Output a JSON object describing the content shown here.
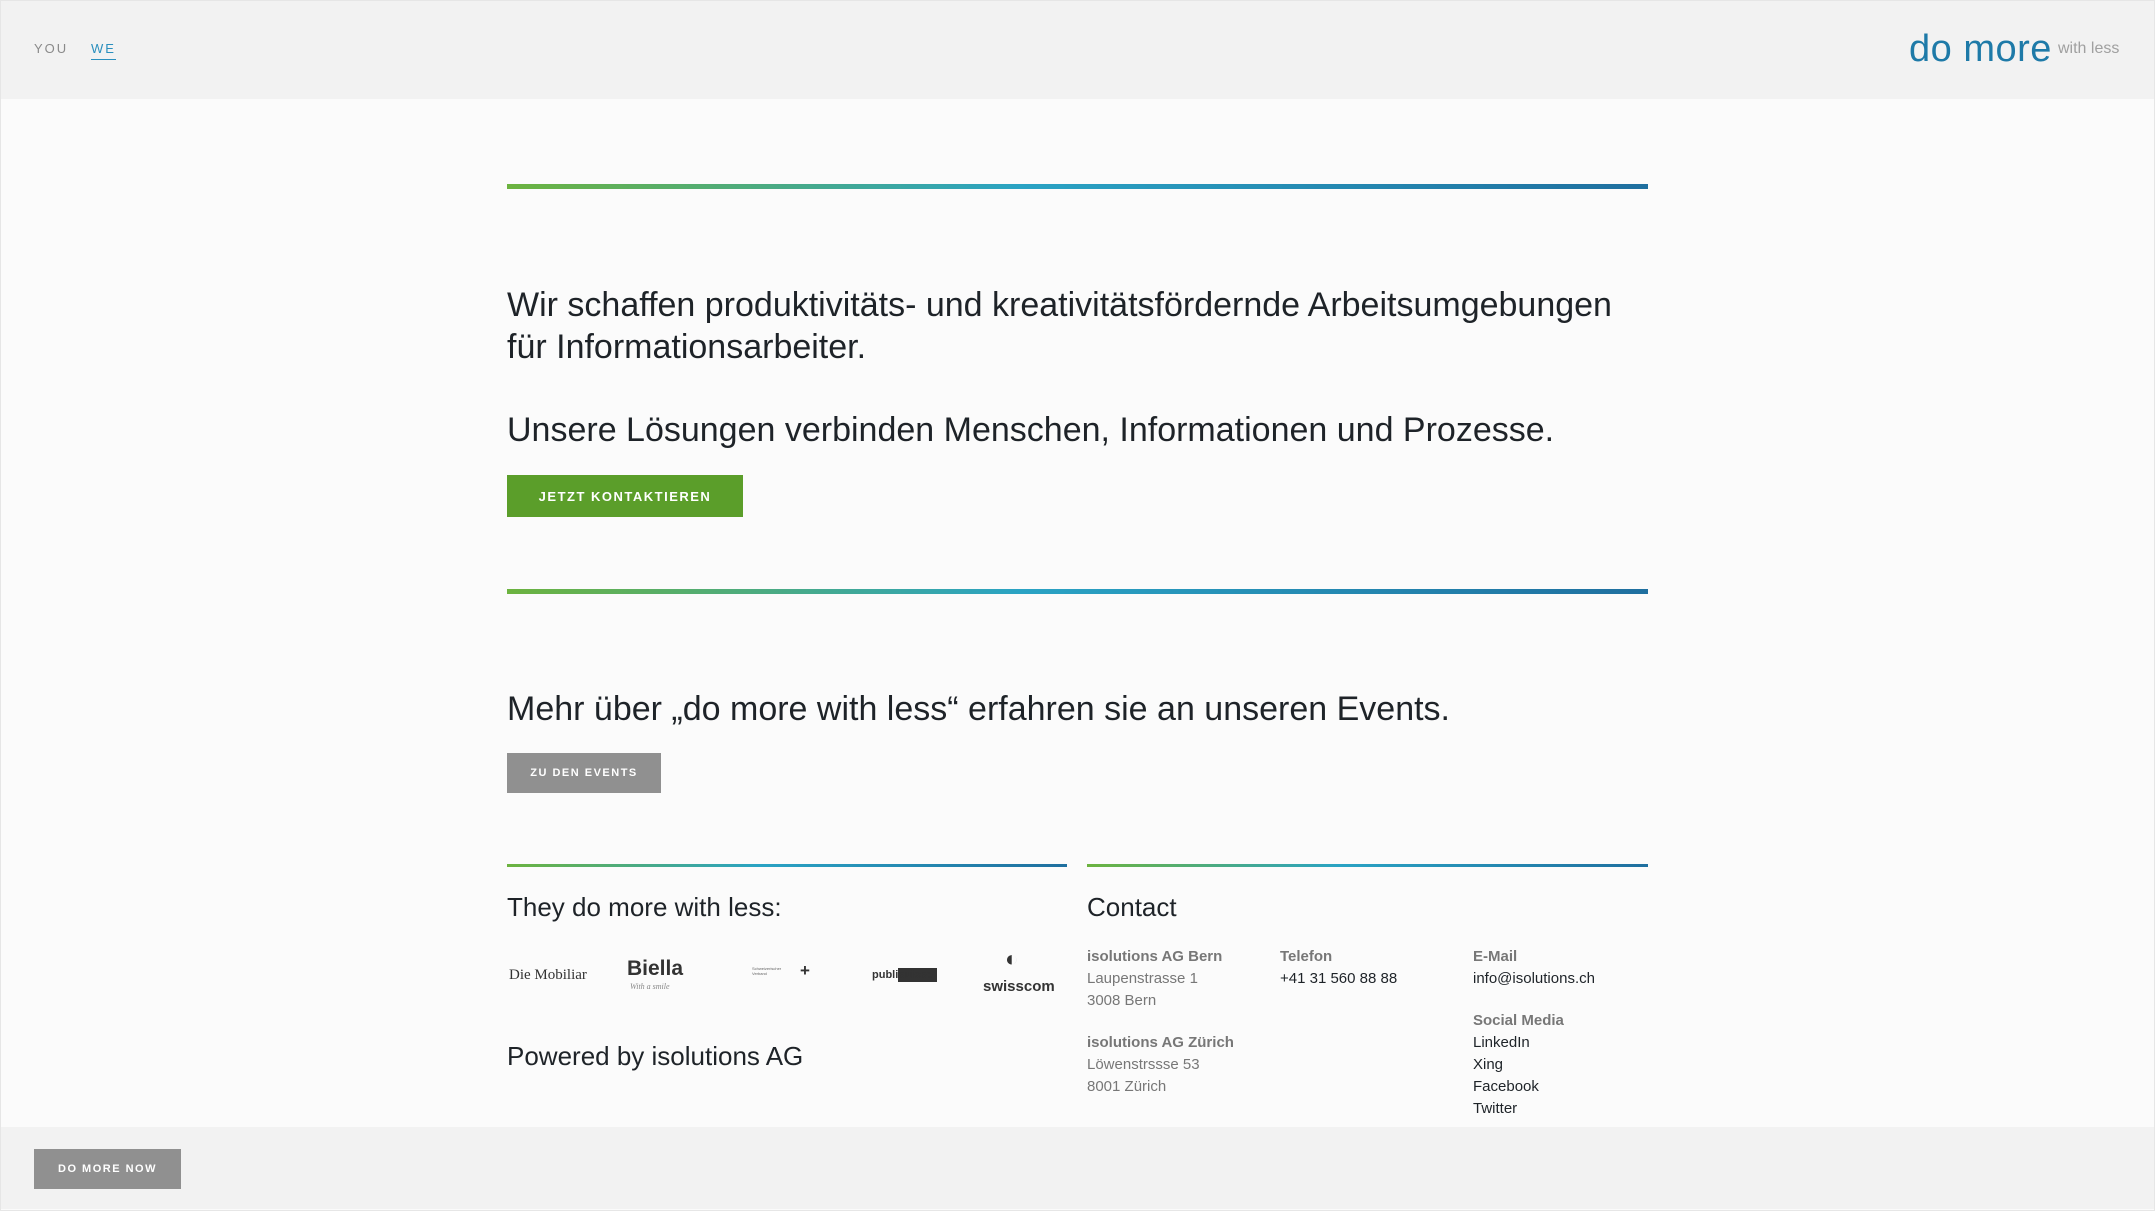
{
  "nav": {
    "you": "YOU",
    "we": "WE"
  },
  "brand": {
    "main": "do more",
    "sub": "with less"
  },
  "intro": {
    "line1": "Wir schaffen produktivitäts- und kreativitätsfördernde Arbeitsumgebungen für Informationsarbeiter.",
    "line2": "Unsere Lösungen verbinden Menschen, Informationen und Prozesse.",
    "cta": "JETZT KONTAKTIEREN"
  },
  "events": {
    "text": "Mehr über „do more with less“ erfahren sie an unseren Events.",
    "cta": "ZU DEN EVENTS"
  },
  "clients": {
    "title": "They do more with less:",
    "logos": [
      "Die Mobiliar",
      "Biella",
      "Schweizerischer Verband",
      "publisuisse",
      "swisscom"
    ],
    "biella_tagline": "With a smile",
    "powered": "Powered by isolutions AG"
  },
  "contact": {
    "title": "Contact",
    "bern": {
      "name": "isolutions AG Bern",
      "street": "Laupenstrasse 1",
      "city": "3008 Bern"
    },
    "zurich": {
      "name": "isolutions AG Zürich",
      "street": "Löwenstrssse 53",
      "city": "8001 Zürich"
    },
    "phone": {
      "label": "Telefon",
      "value": "+41 31 560 88 88"
    },
    "email": {
      "label": "E-Mail",
      "value": "info@isolutions.ch"
    },
    "social": {
      "label": "Social Media",
      "items": [
        "LinkedIn",
        "Xing",
        "Facebook",
        "Twitter"
      ]
    }
  },
  "footer": {
    "cta": "DO MORE NOW"
  },
  "colors": {
    "accent_green": "#5b9e2a",
    "accent_blue": "#1e7aa8",
    "button_gray": "#909090"
  }
}
